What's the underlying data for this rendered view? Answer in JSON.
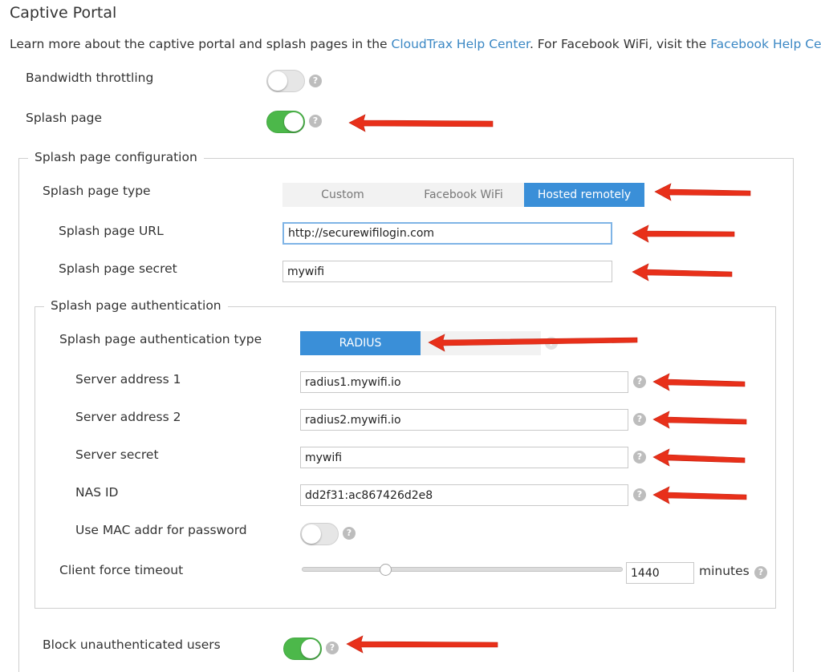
{
  "page": {
    "title": "Captive Portal",
    "intro": {
      "text1": "Learn more about the captive portal and splash pages in the ",
      "link1": "CloudTrax Help Center",
      "text2": ". For Facebook WiFi, visit the ",
      "link2": "Facebook Help Center",
      "text3": "."
    }
  },
  "toggles": {
    "bandwidth_throttling": {
      "label": "Bandwidth throttling",
      "on": false
    },
    "splash_page": {
      "label": "Splash page",
      "on": true
    },
    "use_mac": {
      "label": "Use MAC addr for password",
      "on": false
    },
    "block_unauth": {
      "label": "Block unauthenticated users",
      "on": true
    }
  },
  "splash_config": {
    "legend": "Splash page configuration",
    "type_label": "Splash page type",
    "type_options": [
      "Custom",
      "Facebook WiFi",
      "Hosted remotely"
    ],
    "type_selected": "Hosted remotely",
    "url_label": "Splash page URL",
    "url_value": "http://securewifilogin.com",
    "secret_label": "Splash page secret",
    "secret_value": "mywifi"
  },
  "auth": {
    "legend": "Splash page authentication",
    "type_label": "Splash page authentication type",
    "type_options": [
      "RADIUS"
    ],
    "type_selected": "RADIUS",
    "server1_label": "Server address 1",
    "server1_value": "radius1.mywifi.io",
    "server2_label": "Server address 2",
    "server2_value": "radius2.mywifi.io",
    "server_secret_label": "Server secret",
    "server_secret_value": "mywifi",
    "nas_label": "NAS ID",
    "nas_value": "dd2f31:ac867426d2e8",
    "timeout_label": "Client force timeout",
    "timeout_value": "1440",
    "timeout_unit": "minutes",
    "timeout_slider_level": 0.26
  },
  "icons": {
    "help": "?",
    "help_icon_name": "question-circle-icon",
    "annotation_arrow_name": "red-arrow-icon"
  },
  "colors": {
    "accent": "#3a8fd8",
    "toggle_on": "#4cb84a",
    "link": "#3a87c4",
    "annotation": "#e8301a"
  }
}
